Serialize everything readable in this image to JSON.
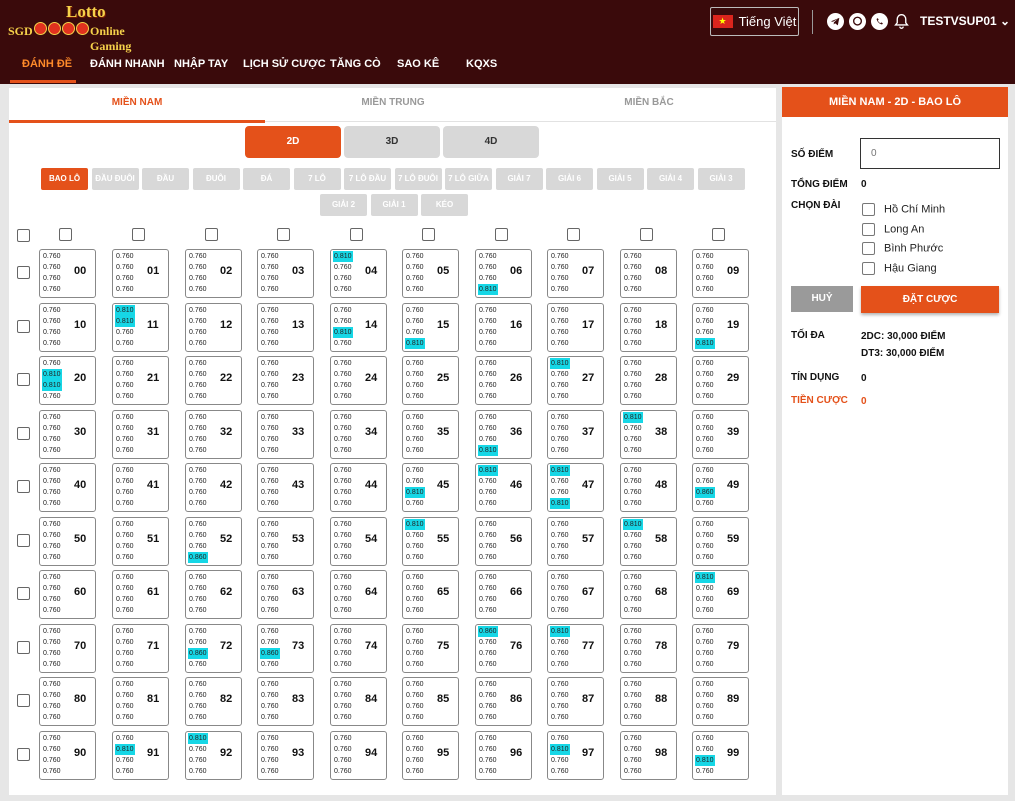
{
  "header": {
    "logo_top": "Lotto",
    "logo_left": "SGD",
    "logo_right": "Online Gaming",
    "language": "Tiếng Việt",
    "flag_star": "★",
    "username": "TESTVSUP01 ⌄"
  },
  "icons": [
    "telegram-icon",
    "viber-icon",
    "whatsapp-icon",
    "bell-icon"
  ],
  "menu": [
    "ĐÁNH ĐỀ",
    "ĐÁNH NHANH",
    "NHẬP TAY",
    "LỊCH SỬ CƯỢC",
    "TĂNG CÒ",
    "SAO KÊ",
    "KQXS"
  ],
  "active_menu": 0,
  "region_tabs": [
    "MIỀN NAM",
    "MIỀN TRUNG",
    "MIỀN BẮC"
  ],
  "active_region": 0,
  "digit_tabs": [
    "2D",
    "3D",
    "4D"
  ],
  "active_digit": 0,
  "bet_types": [
    [
      "BAO LÔ",
      "ĐẦU ĐUÔI",
      "ĐẦU",
      "ĐUÔI",
      "ĐÁ",
      "7 LÔ",
      "7 LÔ ĐẦU",
      "7 LÔ ĐUÔI",
      "7 LÔ GIỮA",
      "GIẢI 7",
      "GIẢI 6",
      "GIẢI 5",
      "GIẢI 4",
      "GIẢI 3"
    ],
    [
      "GIẢI 2",
      "GIẢI 1",
      "KÉO"
    ]
  ],
  "active_bet": "BAO LÔ",
  "base_odds": "0.760",
  "odds_overrides": {
    "4": {
      "0": "0.810"
    },
    "6": {
      "3": "0.810"
    },
    "11": {
      "0": "0.810",
      "1": "0.810"
    },
    "14": {
      "2": "0.810"
    },
    "15": {
      "3": "0.810"
    },
    "19": {
      "3": "0.810"
    },
    "20": {
      "1": "0.810",
      "2": "0.810"
    },
    "27": {
      "0": "0.810"
    },
    "36": {
      "3": "0.810"
    },
    "38": {
      "0": "0.810"
    },
    "45": {
      "2": "0.810"
    },
    "46": {
      "0": "0.810"
    },
    "47": {
      "0": "0.810",
      "3": "0.810"
    },
    "49": {
      "2": "0.860"
    },
    "52": {
      "3": "0.860"
    },
    "55": {
      "0": "0.810"
    },
    "58": {
      "0": "0.810"
    },
    "69": {
      "0": "0.810"
    },
    "72": {
      "2": "0.860"
    },
    "73": {
      "2": "0.860"
    },
    "76": {
      "0": "0.860"
    },
    "77": {
      "0": "0.810"
    },
    "91": {
      "1": "0.810"
    },
    "92": {
      "0": "0.810"
    },
    "97": {
      "1": "0.810"
    },
    "99": {
      "2": "0.810"
    }
  },
  "highlight_color": "#16d7e6",
  "accent_color": "#e4511a",
  "header_color": "#3a0a0b",
  "sidebar": {
    "title": "MIỀN NAM - 2D - BAO LÔ",
    "points_label": "SỐ ĐIỂM",
    "points_placeholder": "0",
    "total_label": "TỔNG ĐIỂM",
    "total_value": "0",
    "station_label": "CHỌN ĐÀI",
    "stations": [
      "Hồ Chí Minh",
      "Long An",
      "Bình Phước",
      "Hậu Giang"
    ],
    "cancel": "HUỶ",
    "submit": "ĐẶT CƯỢC",
    "max_label": "TỐI ĐA",
    "max_2dc": "2DC: 30,000 ĐIỂM",
    "max_dt3": "DT3: 30,000 ĐIỂM",
    "credit_label": "TÍN DỤNG",
    "credit_value": "0",
    "bet_money_label": "TIỀN CƯỢC",
    "bet_money_value": "0"
  }
}
